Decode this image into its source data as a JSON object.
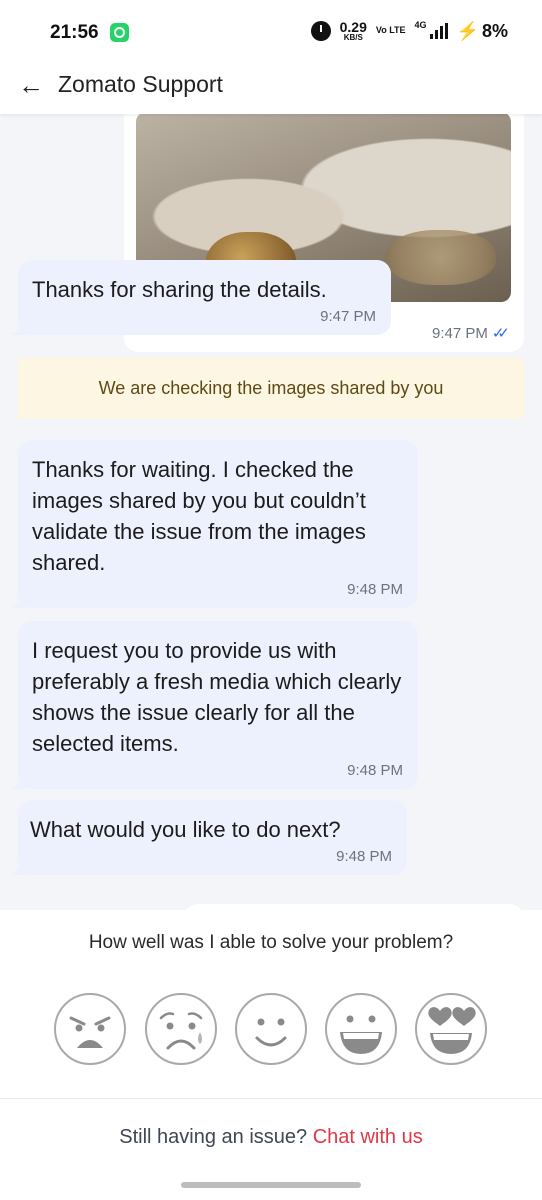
{
  "status_bar": {
    "time": "21:56",
    "net_speed_value": "0.29",
    "net_speed_unit": "KB/S",
    "volte": "Vo LTE",
    "network": "4G",
    "battery": "8%"
  },
  "header": {
    "title": "Zomato Support"
  },
  "chat": {
    "image_message": {
      "time": "9:47 PM"
    },
    "messages": [
      {
        "text": "Thanks for sharing the details.",
        "time": "9:47 PM"
      },
      {
        "text": "Thanks for waiting. I checked the images shared by you but couldn’t validate the issue from the images shared.",
        "time": "9:48 PM"
      },
      {
        "text": "I request you to provide us with preferably a fresh media which clearly shows the issue clearly for all the selected items.",
        "time": "9:48 PM"
      },
      {
        "text": "What would you like to do next?",
        "time": "9:48 PM"
      }
    ],
    "notice": "We are checking the images shared by you"
  },
  "rating": {
    "question": "How well was I able to solve your problem?",
    "options": [
      "angry-face-icon",
      "sad-face-icon",
      "smile-face-icon",
      "grin-face-icon",
      "heart-eyes-face-icon"
    ]
  },
  "footer": {
    "prompt": "Still having an issue?",
    "link": "Chat with us"
  },
  "colors": {
    "accent": "#e23744",
    "agent_bubble": "#edf1fd",
    "notice_bg": "#fdf6e2",
    "read_tick": "#2b6de8"
  }
}
